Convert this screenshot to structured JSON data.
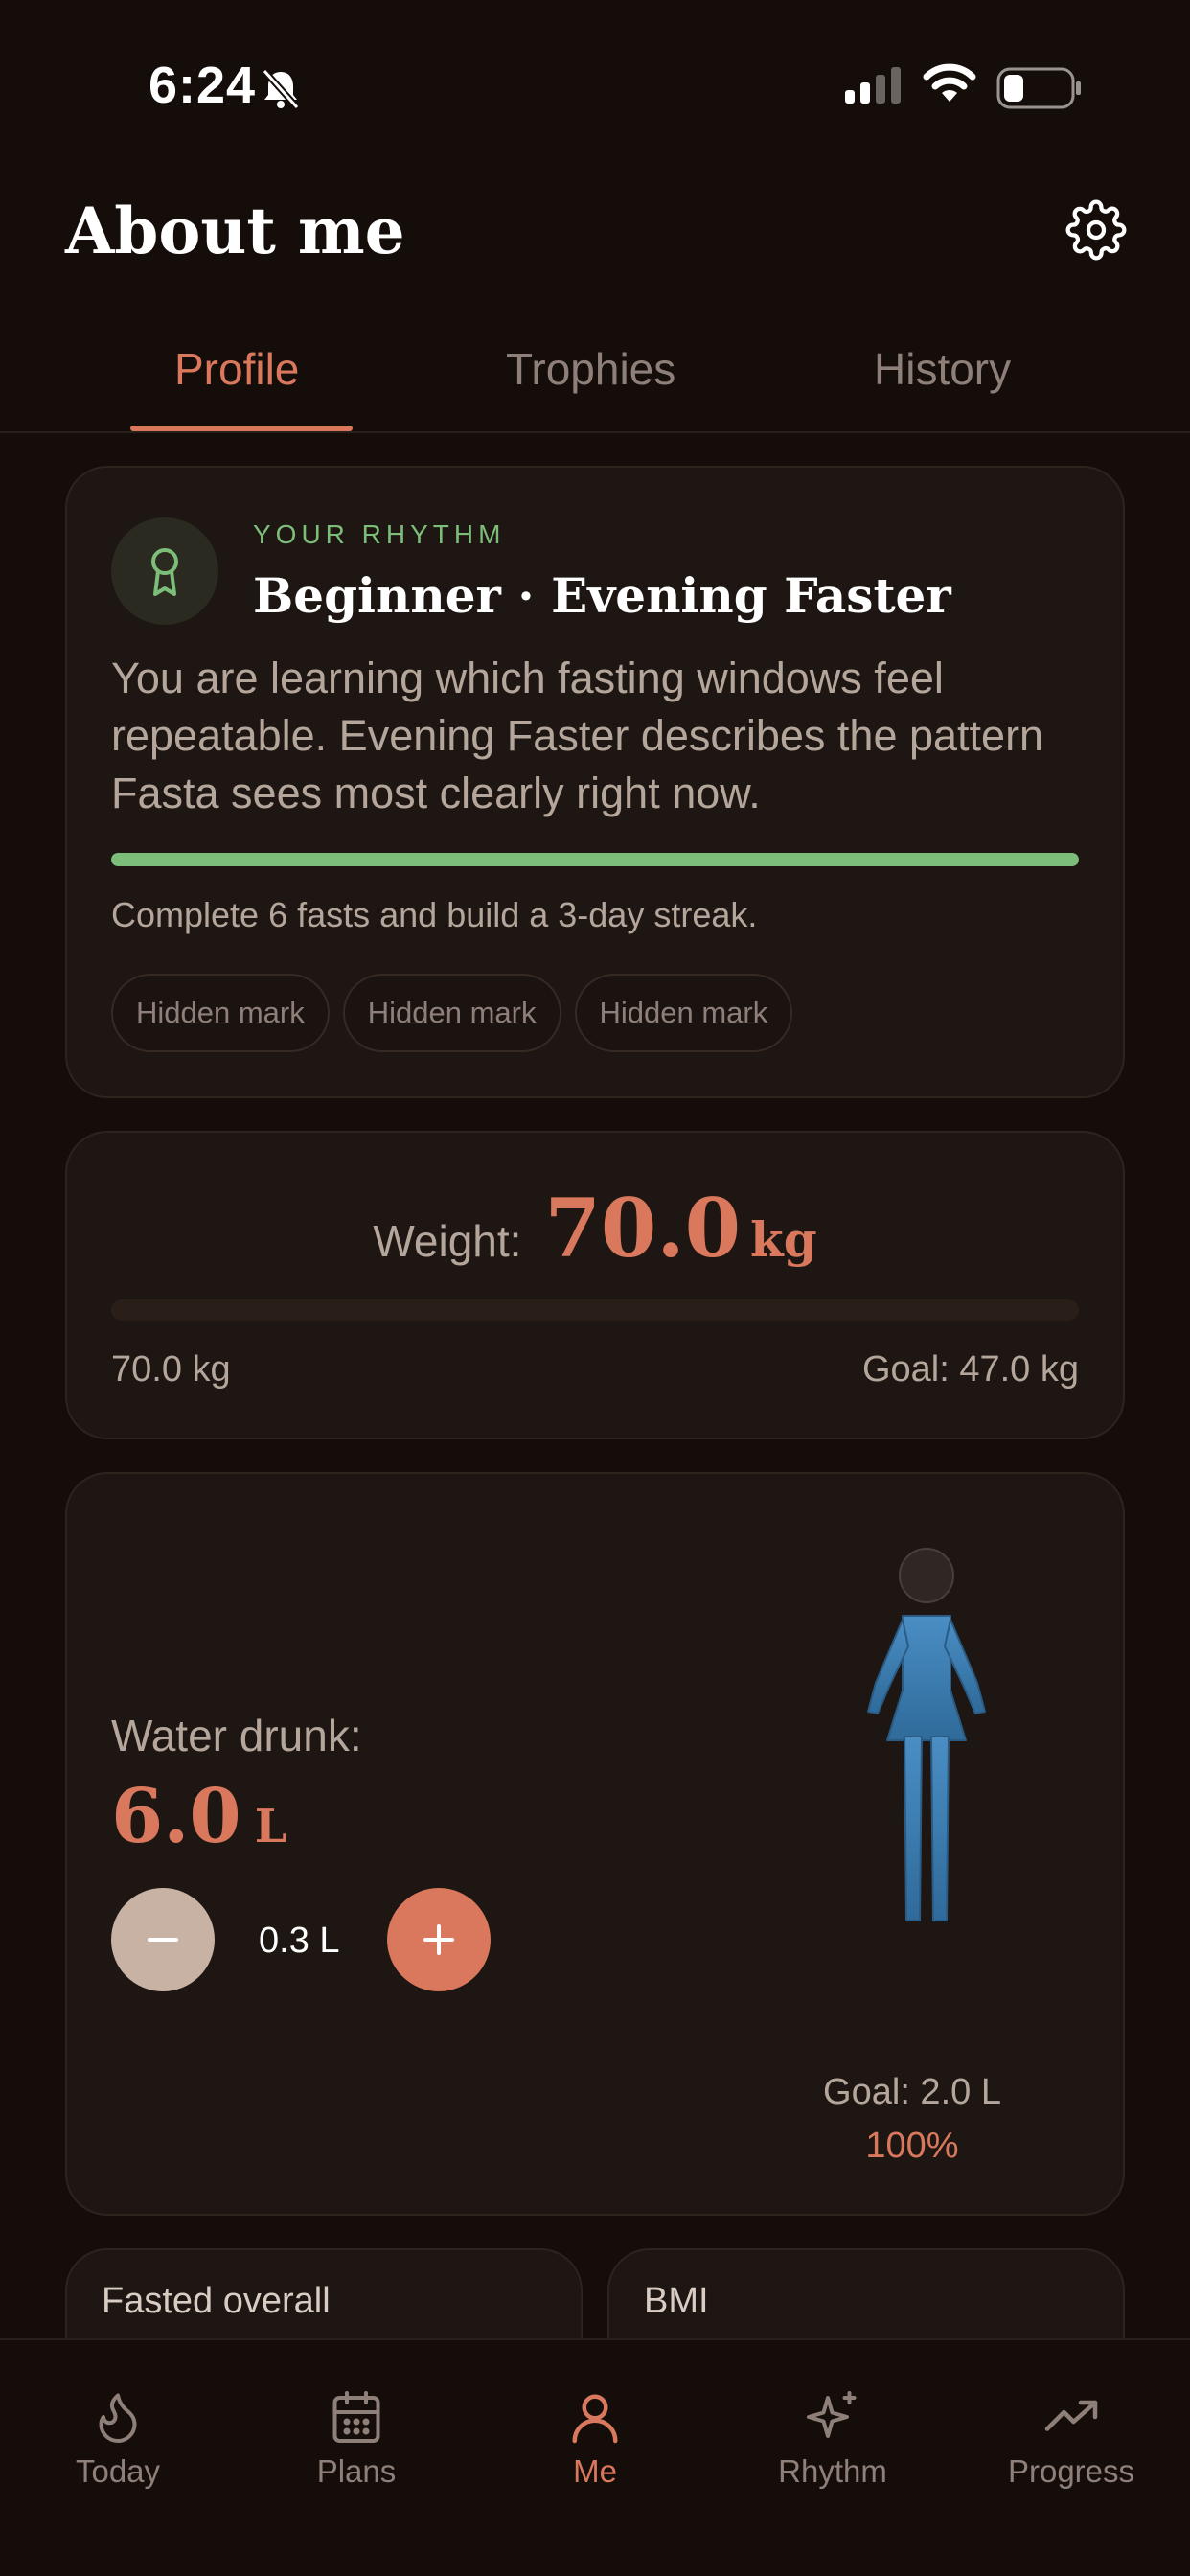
{
  "status_bar": {
    "time": "6:24"
  },
  "header": {
    "title": "About me"
  },
  "tabs": [
    {
      "label": "Profile",
      "active": true
    },
    {
      "label": "Trophies",
      "active": false
    },
    {
      "label": "History",
      "active": false
    }
  ],
  "rhythm": {
    "eyebrow": "YOUR RHYTHM",
    "title": "Beginner · Evening Faster",
    "description": "You are learning which fasting windows feel repeatable. Evening Faster describes the pattern Fasta sees most clearly right now.",
    "progress_fraction": 1.0,
    "goal_text": "Complete 6 fasts and build a 3-day streak.",
    "marks": [
      "Hidden mark",
      "Hidden mark",
      "Hidden mark"
    ]
  },
  "weight": {
    "label": "Weight:",
    "value": "70.0",
    "unit": "kg",
    "current_text": "70.0 kg",
    "goal_text": "Goal: 47.0 kg",
    "progress_fraction": 0.0
  },
  "water": {
    "label": "Water drunk:",
    "value": "6.0",
    "unit": "L",
    "step_text": "0.3 L",
    "goal_text": "Goal: 2.0 L",
    "percent_text": "100%",
    "fill_fraction": 1.0
  },
  "stats": [
    {
      "title": "Fasted overall"
    },
    {
      "title": "BMI"
    }
  ],
  "bottom_nav": [
    {
      "label": "Today",
      "icon": "flame-icon",
      "active": false
    },
    {
      "label": "Plans",
      "icon": "calendar-icon",
      "active": false
    },
    {
      "label": "Me",
      "icon": "person-icon",
      "active": true
    },
    {
      "label": "Rhythm",
      "icon": "sparkle-icon",
      "active": false
    },
    {
      "label": "Progress",
      "icon": "trending-up-icon",
      "active": false
    }
  ],
  "colors": {
    "background": "#140d0a",
    "card": "#1d1612",
    "accent": "#d9785c",
    "green": "#7dbd7a",
    "water_blue": "#3a7cb0"
  }
}
